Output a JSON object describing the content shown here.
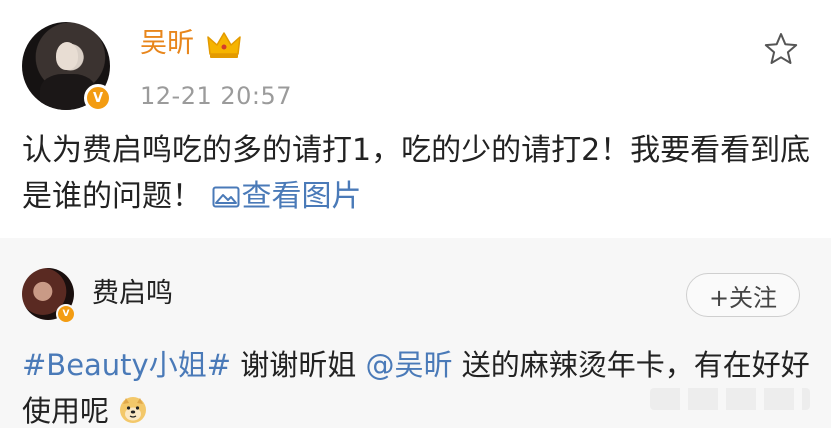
{
  "post": {
    "username": "吴昕",
    "timestamp": "12-21 20:57",
    "text_part1": "认为费启鸣吃的多的请打1，吃的少的请打2！我要看看到底是谁的问题！",
    "view_image_label": "查看图片",
    "verified_badge": "V"
  },
  "repost": {
    "username": "费启鸣",
    "follow_label": "+关注",
    "topic": "#Beauty小姐#",
    "text_a": " 谢谢昕姐 ",
    "mention": "@吴昕",
    "text_b": " 送的麻辣烫年卡，有在好好使用呢",
    "verified_badge": "V"
  },
  "colors": {
    "username_orange": "#e8861c",
    "link_blue": "#4a7ab8",
    "timestamp_gray": "#9b9b9b",
    "repost_bg": "#f7f7f7"
  },
  "icons": {
    "crown": "crown-icon",
    "star": "star-icon",
    "image": "image-icon",
    "doge": "doge-emoji-icon"
  }
}
